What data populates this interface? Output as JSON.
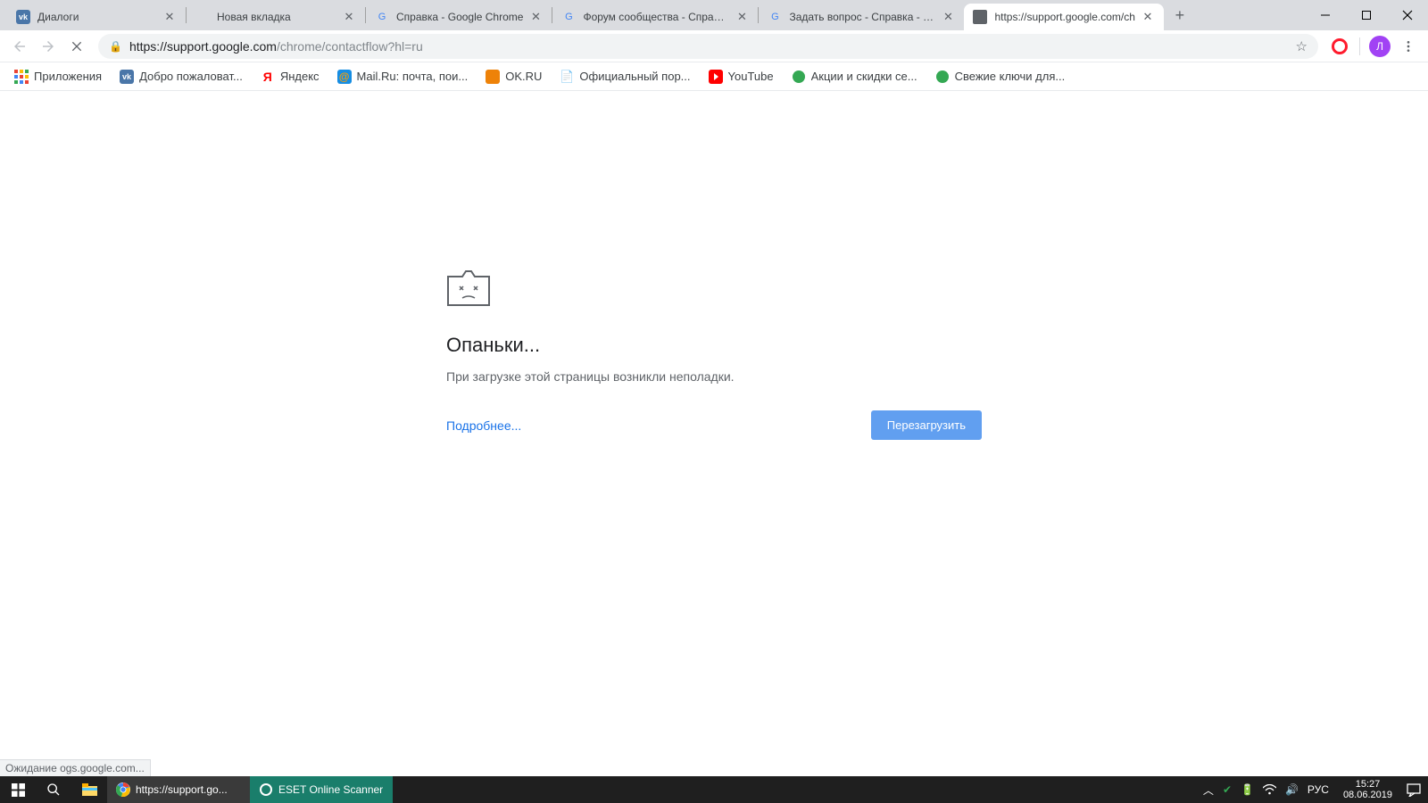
{
  "tabs": [
    {
      "title": "Диалоги"
    },
    {
      "title": "Новая вкладка"
    },
    {
      "title": "Справка - Google Chrome"
    },
    {
      "title": "Форум сообщества - Справка"
    },
    {
      "title": "Задать вопрос - Справка - Go"
    },
    {
      "title": "https://support.google.com/ch"
    }
  ],
  "url": {
    "host": "https://support.google.com",
    "path": "/chrome/contactflow?hl=ru"
  },
  "avatar_letter": "Л",
  "bookmarks": [
    {
      "label": "Приложения"
    },
    {
      "label": "Добро пожаловат..."
    },
    {
      "label": "Яндекс"
    },
    {
      "label": "Mail.Ru: почта, пои..."
    },
    {
      "label": "OK.RU"
    },
    {
      "label": "Официальный пор..."
    },
    {
      "label": "YouTube"
    },
    {
      "label": "Акции и скидки се..."
    },
    {
      "label": "Свежие ключи для..."
    }
  ],
  "error": {
    "title": "Опаньки...",
    "message": "При загрузке этой страницы возникли неполадки.",
    "more": "Подробнее...",
    "reload": "Перезагрузить"
  },
  "status": "Ожидание ogs.google.com...",
  "taskbar": {
    "tasks": [
      {
        "label": "https://support.go..."
      },
      {
        "label": "ESET Online Scanner"
      }
    ],
    "lang": "РУС",
    "time": "15:27",
    "date": "08.06.2019"
  }
}
